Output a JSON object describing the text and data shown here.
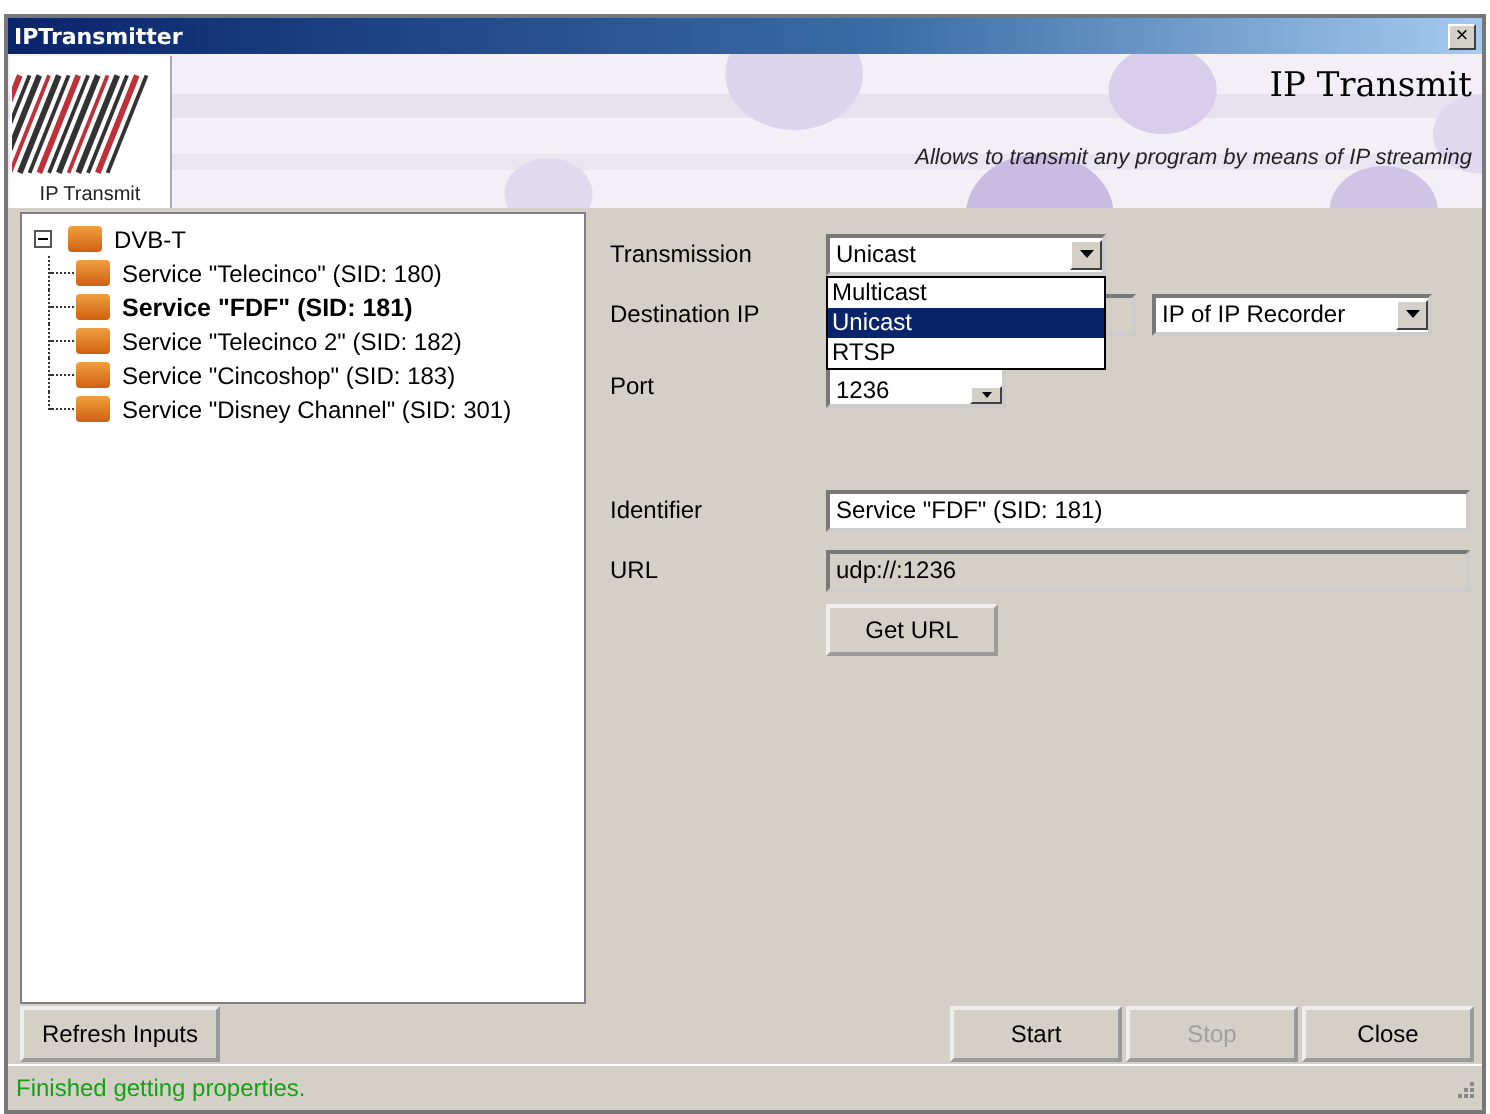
{
  "window": {
    "title": "IPTransmitter",
    "close_glyph": "×"
  },
  "header": {
    "logo_caption": "IP Transmit",
    "title": "IP Transmit",
    "subtitle": "Allows to transmit any program by means of IP streaming"
  },
  "tree": {
    "label": "DVB-T",
    "expanded": true,
    "children": [
      {
        "label": "Service \"Telecinco\" (SID: 180)",
        "selected": false
      },
      {
        "label": "Service \"FDF\" (SID: 181)",
        "selected": true
      },
      {
        "label": "Service \"Telecinco 2\" (SID: 182)",
        "selected": false
      },
      {
        "label": "Service \"Cincoshop\" (SID: 183)",
        "selected": false
      },
      {
        "label": "Service \"Disney Channel\" (SID: 301)",
        "selected": false
      }
    ]
  },
  "form": {
    "transmission": {
      "label": "Transmission",
      "value": "Unicast",
      "open": true,
      "options": [
        {
          "label": "Multicast",
          "selected": false
        },
        {
          "label": "Unicast",
          "selected": true
        },
        {
          "label": "RTSP",
          "selected": false
        }
      ]
    },
    "destination": {
      "label": "Destination IP",
      "selector": "IP of IP Recorder"
    },
    "port": {
      "label": "Port",
      "value": "1236"
    },
    "identifier": {
      "label": "Identifier",
      "value": "Service \"FDF\" (SID: 181)"
    },
    "url": {
      "label": "URL",
      "value": "udp://:1236"
    },
    "get_url": "Get URL"
  },
  "buttons": [
    {
      "label": "Refresh Inputs",
      "disabled": false
    },
    {
      "label": "Start",
      "disabled": false
    },
    {
      "label": "Stop",
      "disabled": true
    },
    {
      "label": "Close",
      "disabled": false
    }
  ],
  "status_bar": "Finished getting properties."
}
